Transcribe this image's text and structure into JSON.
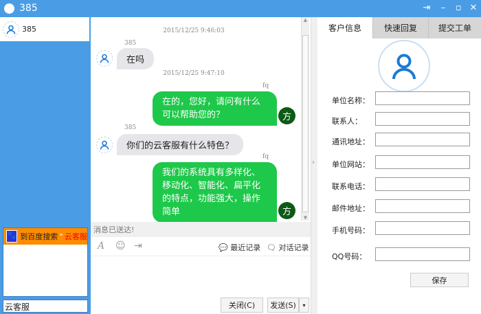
{
  "window": {
    "title": "385"
  },
  "left": {
    "contact_name": "385",
    "baidu_prefix": "到百度搜索",
    "baidu_quote_open": "“",
    "baidu_term": "云客服",
    "search_value": "云客服"
  },
  "chat": {
    "messages": [
      {
        "time": "2015/12/25 9:46:03",
        "sender": "385",
        "text": "在吗",
        "dir": "in"
      },
      {
        "time": "2015/12/25 9:47:10",
        "sender": "fq",
        "text": "在的，您好，请问有什么可以帮助您的？",
        "dir": "out",
        "avatar": "方"
      },
      {
        "sender": "385",
        "text": "你们的云客服有什么特色？",
        "dir": "in"
      },
      {
        "sender": "fq",
        "text": "我们的系统具有多样化、移动化、智能化、扁平化的特点，功能强大，操作简单",
        "dir": "out",
        "avatar": "方"
      }
    ],
    "status": "消息已送达!",
    "recent_label": "最近记录",
    "history_label": "对话记录",
    "close_label": "关闭(C)",
    "send_label": "发送(S)"
  },
  "right": {
    "tabs": [
      "客户信息",
      "快速回复",
      "提交工单"
    ],
    "fields": [
      "单位名称：",
      "联系人：",
      "通讯地址：",
      "单位网站：",
      "联系电话：",
      "邮件地址：",
      "手机号码：",
      "QQ号码："
    ],
    "save_label": "保存"
  },
  "colors": {
    "accent": "#4a9de4",
    "bubble_out": "#1ec84a",
    "bubble_in": "#e6e6ea"
  }
}
